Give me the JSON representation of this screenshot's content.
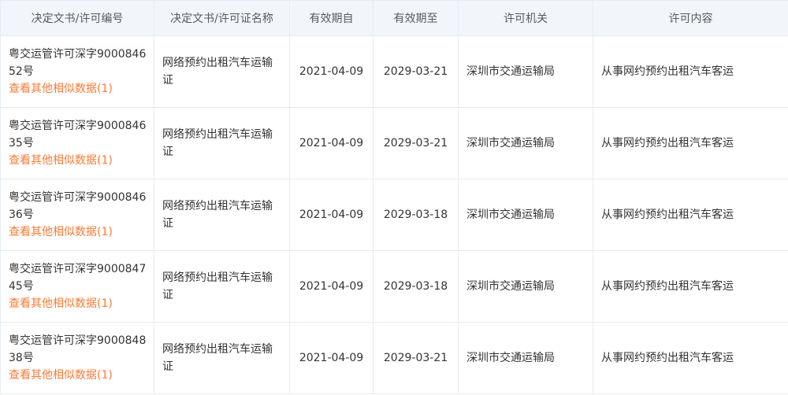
{
  "headers": {
    "doc_number": "决定文书/许可编号",
    "doc_name": "决定文书/许可证名称",
    "valid_from": "有效期自",
    "valid_to": "有效期至",
    "authority": "许可机关",
    "content": "许可内容"
  },
  "rows": [
    {
      "doc_number": "粤交运管许可深字900084652号",
      "similar_link": "查看其他相似数据(1)",
      "doc_name": "网络预约出租汽车运输证",
      "valid_from": "2021-04-09",
      "valid_to": "2029-03-21",
      "authority": "深圳市交通运输局",
      "content": "从事网约预约出租汽车客运"
    },
    {
      "doc_number": "粤交运管许可深字900084635号",
      "similar_link": "查看其他相似数据(1)",
      "doc_name": "网络预约出租汽车运输证",
      "valid_from": "2021-04-09",
      "valid_to": "2029-03-21",
      "authority": "深圳市交通运输局",
      "content": "从事网约预约出租汽车客运"
    },
    {
      "doc_number": "粤交运管许可深字900084636号",
      "similar_link": "查看其他相似数据(1)",
      "doc_name": "网络预约出租汽车运输证",
      "valid_from": "2021-04-09",
      "valid_to": "2029-03-18",
      "authority": "深圳市交通运输局",
      "content": "从事网约预约出租汽车客运"
    },
    {
      "doc_number": "粤交运管许可深字900084745号",
      "similar_link": "查看其他相似数据(1)",
      "doc_name": "网络预约出租汽车运输证",
      "valid_from": "2021-04-09",
      "valid_to": "2029-03-18",
      "authority": "深圳市交通运输局",
      "content": "从事网约预约出租汽车客运"
    },
    {
      "doc_number": "粤交运管许可深字900084838号",
      "similar_link": "查看其他相似数据(1)",
      "doc_name": "网络预约出租汽车运输证",
      "valid_from": "2021-04-09",
      "valid_to": "2029-03-21",
      "authority": "深圳市交通运输局",
      "content": "从事网约预约出租汽车客运"
    }
  ],
  "colors": {
    "header_bg": "#f2f6fa",
    "border": "#e6ecf2",
    "link": "#fc7a35",
    "text": "#333333"
  }
}
